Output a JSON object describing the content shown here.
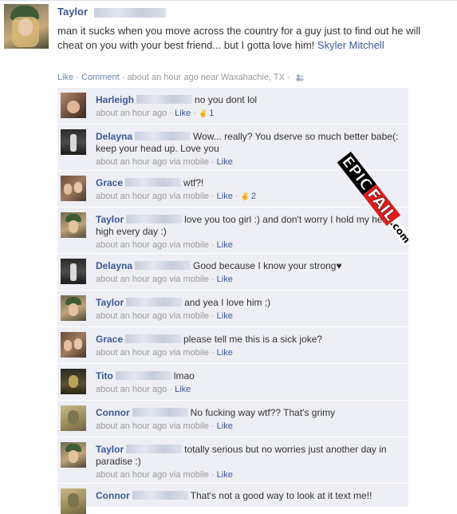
{
  "post": {
    "author": "Taylor",
    "text": "man it sucks when you move across the country for a guy just to find out he will cheat on you with your best friend... but I gotta love him! ",
    "mention": "Skyler Mitchell",
    "actions": {
      "like": "Like",
      "comment": "Comment"
    },
    "meta": "about an hour ago near Waxahachie, TX",
    "separator": " · "
  },
  "stamp": {
    "epic": "EPIC",
    "fail": "FAIL",
    "dotcom": ".com"
  },
  "comments": [
    {
      "name": "Harleigh",
      "text": "no you dont lol",
      "time": "about an hour ago",
      "via": "",
      "like": "Like",
      "likes": "1",
      "avatar": "harleigh",
      "height": 46
    },
    {
      "name": "Delayna",
      "text": "Wow... really? You dserve so much better babe(: keep your head up. Love you",
      "time": "about an hour ago",
      "via": " via mobile",
      "like": "Like",
      "likes": "",
      "avatar": "delayna",
      "height": 58
    },
    {
      "name": "Grace",
      "text": "wtf?!",
      "time": "about an hour ago",
      "via": " via mobile",
      "like": "Like",
      "likes": "2",
      "avatar": "grace",
      "height": 46
    },
    {
      "name": "Taylor",
      "text": "love you too girl :) and don't worry I hold my head high every day :)",
      "time": "about an hour ago",
      "via": " via mobile",
      "like": "Like",
      "likes": "",
      "avatar": "taylor",
      "height": 58
    },
    {
      "name": "Delayna",
      "text": "Good because I know your strong♥",
      "time": "about an hour ago",
      "via": " via mobile",
      "like": "Like",
      "likes": "",
      "avatar": "delayna",
      "height": 46
    },
    {
      "name": "Taylor",
      "text": "and yea I love him ;)",
      "time": "about an hour ago",
      "via": " via mobile",
      "like": "Like",
      "likes": "",
      "avatar": "taylor",
      "height": 46
    },
    {
      "name": "Grace",
      "text": "please tell me this is a sick joke?",
      "time": "about an hour ago",
      "via": " via mobile",
      "like": "Like",
      "likes": "",
      "avatar": "grace",
      "height": 46
    },
    {
      "name": "Tito",
      "text": "lmao",
      "time": "about an hour ago",
      "via": "",
      "like": "Like",
      "likes": "",
      "avatar": "tito",
      "height": 46
    },
    {
      "name": "Connor",
      "text": "No fucking way wtf?? That's grimy",
      "time": "about an hour ago",
      "via": " via mobile",
      "like": "Like",
      "likes": "",
      "avatar": "connor",
      "height": 46
    },
    {
      "name": "Taylor",
      "text": "totally serious but no worries just another day in paradise :)",
      "time": "about an hour ago",
      "via": " via mobile",
      "like": "Like",
      "likes": "",
      "avatar": "taylor",
      "height": 58
    },
    {
      "name": "Connor",
      "text": "That's not a good way to look at it text me!!",
      "time": "",
      "via": "",
      "like": "",
      "likes": "",
      "avatar": "connor",
      "height": 30
    }
  ]
}
